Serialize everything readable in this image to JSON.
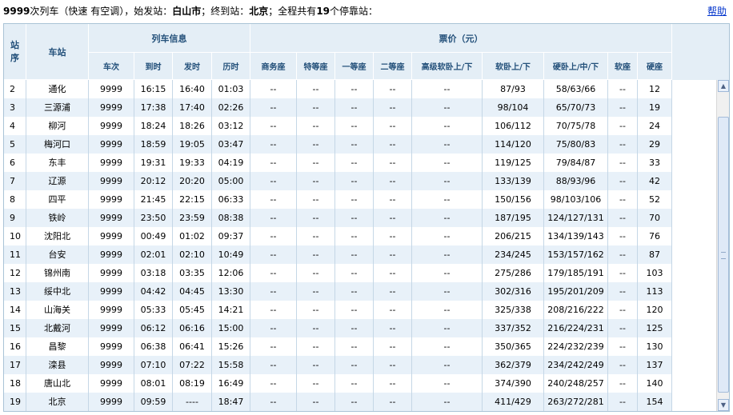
{
  "title": {
    "train_no": "9999",
    "part_train": "次列车",
    "part_type": "（快速 有空调），始发站：",
    "origin": "白山市",
    "part_dest": "；终到站：",
    "destination": "北京",
    "part_stops": "；全程共有",
    "stop_count": "19",
    "part_end": "个停靠站："
  },
  "help_label": "帮助",
  "header": {
    "seq": "站\n序",
    "station": "车站",
    "train_info": "列车信息",
    "price": "票价（元）",
    "sub": [
      "车次",
      "到时",
      "发时",
      "历时",
      "商务座",
      "特等座",
      "一等座",
      "二等座",
      "高级软卧上/下",
      "软卧上/下",
      "硬卧上/中/下",
      "软座",
      "硬座"
    ]
  },
  "rows": [
    [
      "2",
      "通化",
      "9999",
      "16:15",
      "16:40",
      "01:03",
      "--",
      "--",
      "--",
      "--",
      "--",
      "87/93",
      "58/63/66",
      "--",
      "12"
    ],
    [
      "3",
      "三源浦",
      "9999",
      "17:38",
      "17:40",
      "02:26",
      "--",
      "--",
      "--",
      "--",
      "--",
      "98/104",
      "65/70/73",
      "--",
      "19"
    ],
    [
      "4",
      "柳河",
      "9999",
      "18:24",
      "18:26",
      "03:12",
      "--",
      "--",
      "--",
      "--",
      "--",
      "106/112",
      "70/75/78",
      "--",
      "24"
    ],
    [
      "5",
      "梅河口",
      "9999",
      "18:59",
      "19:05",
      "03:47",
      "--",
      "--",
      "--",
      "--",
      "--",
      "114/120",
      "75/80/83",
      "--",
      "29"
    ],
    [
      "6",
      "东丰",
      "9999",
      "19:31",
      "19:33",
      "04:19",
      "--",
      "--",
      "--",
      "--",
      "--",
      "119/125",
      "79/84/87",
      "--",
      "33"
    ],
    [
      "7",
      "辽源",
      "9999",
      "20:12",
      "20:20",
      "05:00",
      "--",
      "--",
      "--",
      "--",
      "--",
      "133/139",
      "88/93/96",
      "--",
      "42"
    ],
    [
      "8",
      "四平",
      "9999",
      "21:45",
      "22:15",
      "06:33",
      "--",
      "--",
      "--",
      "--",
      "--",
      "150/156",
      "98/103/106",
      "--",
      "52"
    ],
    [
      "9",
      "铁岭",
      "9999",
      "23:50",
      "23:59",
      "08:38",
      "--",
      "--",
      "--",
      "--",
      "--",
      "187/195",
      "124/127/131",
      "--",
      "70"
    ],
    [
      "10",
      "沈阳北",
      "9999",
      "00:49",
      "01:02",
      "09:37",
      "--",
      "--",
      "--",
      "--",
      "--",
      "206/215",
      "134/139/143",
      "--",
      "76"
    ],
    [
      "11",
      "台安",
      "9999",
      "02:01",
      "02:10",
      "10:49",
      "--",
      "--",
      "--",
      "--",
      "--",
      "234/245",
      "153/157/162",
      "--",
      "87"
    ],
    [
      "12",
      "锦州南",
      "9999",
      "03:18",
      "03:35",
      "12:06",
      "--",
      "--",
      "--",
      "--",
      "--",
      "275/286",
      "179/185/191",
      "--",
      "103"
    ],
    [
      "13",
      "绥中北",
      "9999",
      "04:42",
      "04:45",
      "13:30",
      "--",
      "--",
      "--",
      "--",
      "--",
      "302/316",
      "195/201/209",
      "--",
      "113"
    ],
    [
      "14",
      "山海关",
      "9999",
      "05:33",
      "05:45",
      "14:21",
      "--",
      "--",
      "--",
      "--",
      "--",
      "325/338",
      "208/216/222",
      "--",
      "120"
    ],
    [
      "15",
      "北戴河",
      "9999",
      "06:12",
      "06:16",
      "15:00",
      "--",
      "--",
      "--",
      "--",
      "--",
      "337/352",
      "216/224/231",
      "--",
      "125"
    ],
    [
      "16",
      "昌黎",
      "9999",
      "06:38",
      "06:41",
      "15:26",
      "--",
      "--",
      "--",
      "--",
      "--",
      "350/365",
      "224/232/239",
      "--",
      "130"
    ],
    [
      "17",
      "滦县",
      "9999",
      "07:10",
      "07:22",
      "15:58",
      "--",
      "--",
      "--",
      "--",
      "--",
      "362/379",
      "234/242/249",
      "--",
      "137"
    ],
    [
      "18",
      "唐山北",
      "9999",
      "08:01",
      "08:19",
      "16:49",
      "--",
      "--",
      "--",
      "--",
      "--",
      "374/390",
      "240/248/257",
      "--",
      "140"
    ],
    [
      "19",
      "北京",
      "9999",
      "09:59",
      "----",
      "18:47",
      "--",
      "--",
      "--",
      "--",
      "--",
      "411/429",
      "263/272/281",
      "--",
      "154"
    ]
  ],
  "scrollbar": {
    "up_glyph": "▲",
    "down_glyph": "▼"
  },
  "colors": {
    "header_bg": "#e4eef6",
    "header_text": "#23507a",
    "stripe": "#e8f1f9",
    "link": "#0033cc"
  }
}
